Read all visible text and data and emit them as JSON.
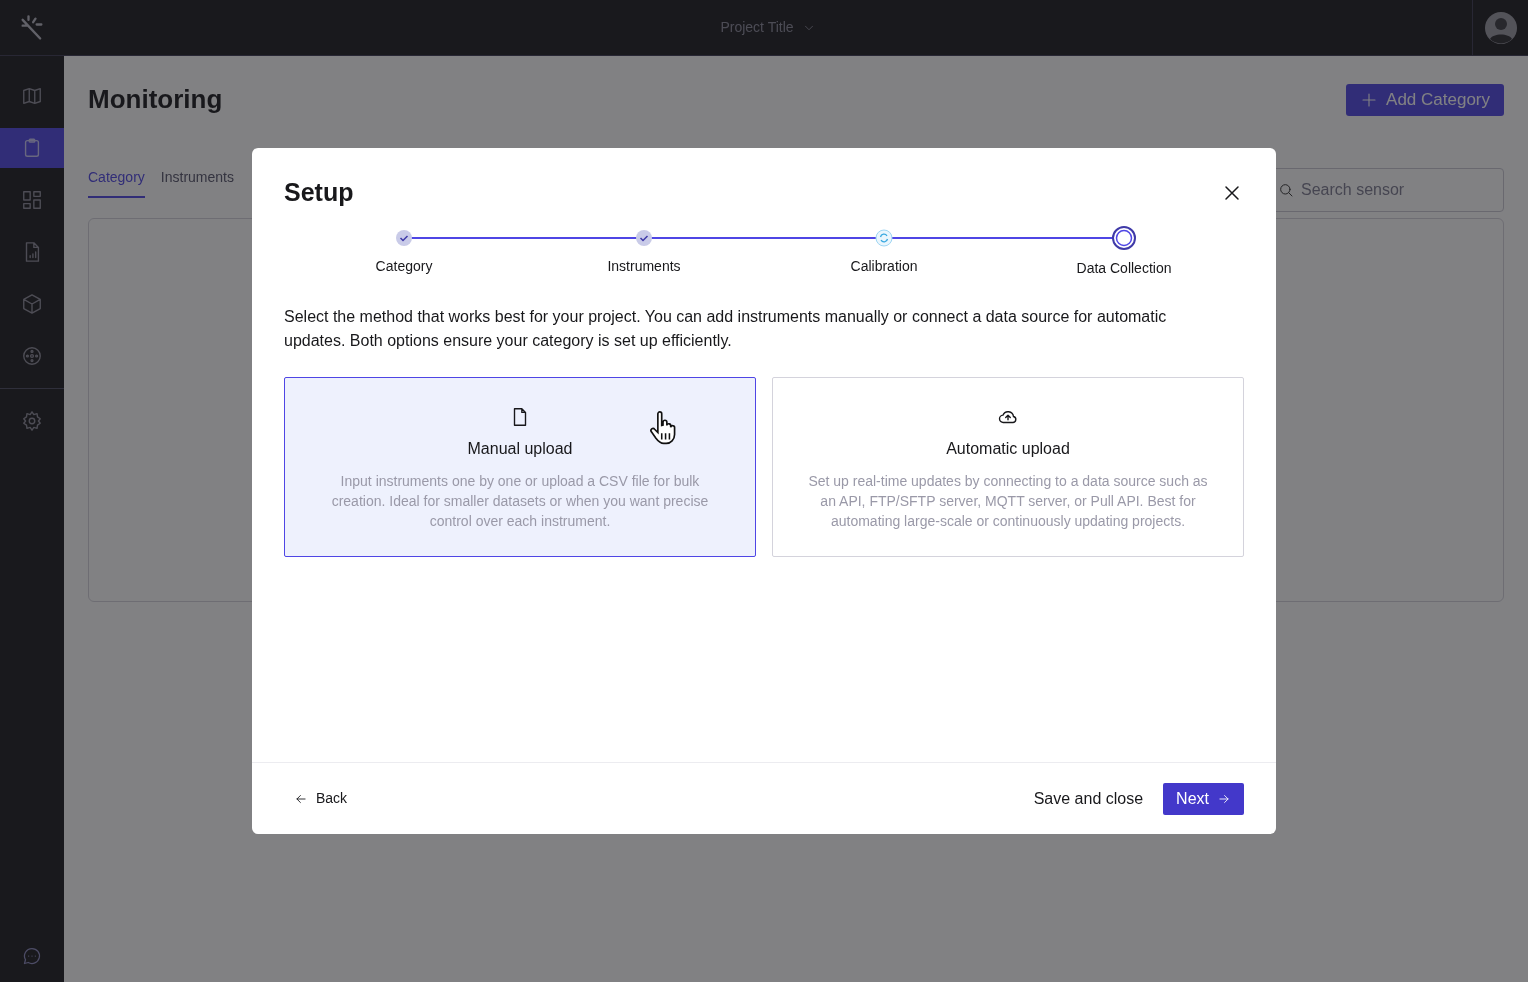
{
  "top_bar": {
    "project_title": "Project Title"
  },
  "sidebar": {
    "items": [
      {
        "selected": false
      },
      {
        "selected": true
      },
      {
        "selected": false
      },
      {
        "selected": false
      },
      {
        "selected": false
      },
      {
        "selected": false
      }
    ],
    "bottom_items": [
      {
        "selected": false
      }
    ]
  },
  "page": {
    "title": "Monitoring",
    "add_button": "Add Category",
    "tabs": [
      {
        "label": "Category",
        "selected": true
      },
      {
        "label": "Instruments",
        "selected": false
      }
    ],
    "search": {
      "placeholder": "Search sensor"
    }
  },
  "dialog": {
    "title": "Setup",
    "steps": [
      {
        "label": "Category",
        "kind": "done"
      },
      {
        "label": "Instruments",
        "kind": "done"
      },
      {
        "label": "Calibration",
        "kind": "syncing"
      },
      {
        "label": "Data Collection",
        "kind": "current"
      }
    ],
    "description": "Select the method that works best for your project. You can add instruments manually or connect a data source for automatic updates. Both options ensure your category is set up efficiently.",
    "options": [
      {
        "kind": "manual",
        "title": "Manual upload",
        "description": "Input instruments one by one or upload a CSV file for bulk creation. Ideal for smaller datasets or when you want precise control over each instrument.",
        "selected": true
      },
      {
        "kind": "automatic",
        "title": "Automatic upload",
        "description": "Set up real-time updates by connecting to a data source such as an API, FTP/SFTP server, MQTT server, or Pull API. Best for automating large-scale or continuously updating projects.",
        "selected": false
      }
    ],
    "back_button": "Back",
    "save_button": "Save and close",
    "next_button": "Next"
  }
}
